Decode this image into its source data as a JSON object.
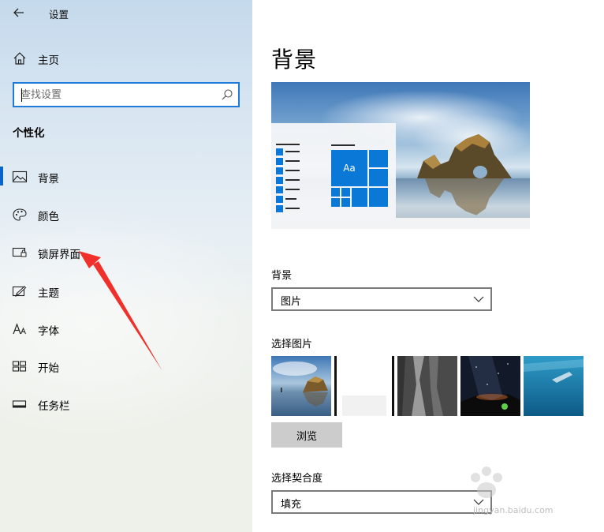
{
  "window": {
    "title": "设置"
  },
  "sidebar": {
    "home_label": "主页",
    "search_placeholder": "查找设置",
    "section_title": "个性化",
    "items": [
      {
        "label": "背景",
        "icon": "picture-icon",
        "active": true
      },
      {
        "label": "颜色",
        "icon": "palette-icon",
        "active": false
      },
      {
        "label": "锁屏界面",
        "icon": "lock-screen-icon",
        "active": false
      },
      {
        "label": "主题",
        "icon": "theme-brush-icon",
        "active": false
      },
      {
        "label": "字体",
        "icon": "font-icon",
        "active": false
      },
      {
        "label": "开始",
        "icon": "start-grid-icon",
        "active": false
      },
      {
        "label": "任务栏",
        "icon": "taskbar-icon",
        "active": false
      }
    ]
  },
  "main": {
    "title": "背景",
    "preview": {
      "tile_label": "Aa"
    },
    "background_label": "背景",
    "background_value": "图片",
    "choose_picture_label": "选择图片",
    "browse_label": "浏览",
    "fit_label": "选择契合度",
    "fit_value": "填充"
  },
  "watermark": {
    "text": "jingyan.baidu.com"
  },
  "colors": {
    "accent": "#0a78d7",
    "active_bar": "#0a64c8",
    "arrow": "#f0302a"
  }
}
